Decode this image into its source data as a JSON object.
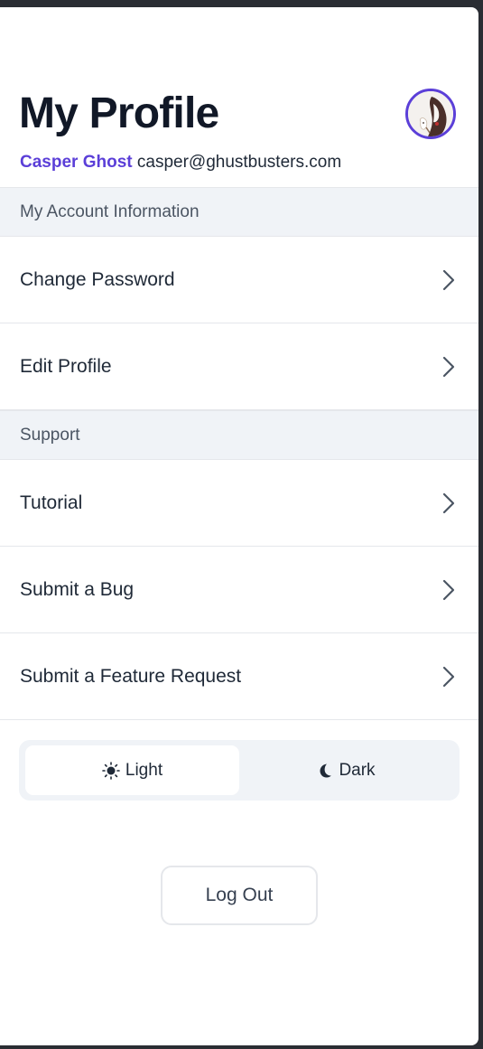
{
  "header": {
    "title": "My Profile",
    "user_name": "Casper Ghost",
    "user_email": "casper@ghustbusters.com"
  },
  "sections": {
    "account": {
      "title": "My Account Information",
      "items": [
        "Change Password",
        "Edit Profile"
      ]
    },
    "support": {
      "title": "Support",
      "items": [
        "Tutorial",
        "Submit a Bug",
        "Submit a Feature Request"
      ]
    }
  },
  "theme": {
    "light_label": "Light",
    "dark_label": "Dark",
    "selected": "Light"
  },
  "logout_label": "Log Out",
  "colors": {
    "accent": "#5b3fd8",
    "section_bg": "#f0f3f7",
    "text": "#1f2937"
  },
  "icons": {
    "avatar": "ghost-avatar",
    "chevron": "chevron-right-icon",
    "light": "sun-icon",
    "dark": "moon-icon"
  }
}
